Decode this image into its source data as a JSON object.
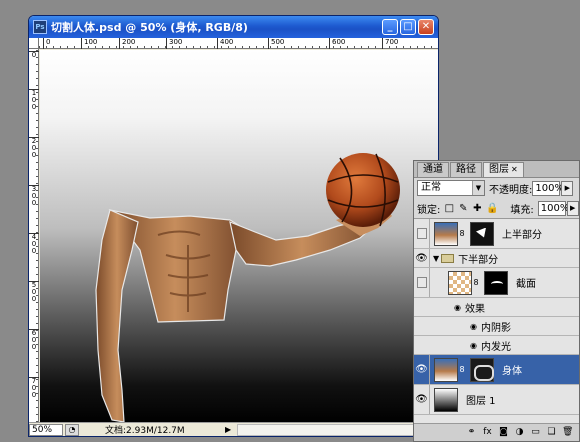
{
  "window": {
    "title": "切割人体.psd @ 50% (身体, RGB/8)",
    "buttons": {
      "minimize": "_",
      "maximize": "□",
      "close": "✕"
    }
  },
  "ruler": {
    "top_ticks": [
      "0",
      "100",
      "200",
      "300",
      "400",
      "500",
      "600",
      "700"
    ],
    "left_ticks": [
      "0",
      "1 0 0",
      "2 0 0",
      "3 0 0",
      "4 0 0",
      "5 0 0",
      "6 0 0",
      "7 0 0"
    ]
  },
  "status": {
    "zoom": "50%",
    "doc_size": "文档:2.93M/12.7M"
  },
  "layers_panel": {
    "tabs": [
      "通道",
      "路径",
      "图层"
    ],
    "active_tab": "图层",
    "blend_mode": "正常",
    "opacity_label": "不透明度:",
    "opacity_value": "100%",
    "lock_label": "锁定:",
    "fill_label": "填充:",
    "fill_value": "100%",
    "layers": [
      {
        "name": "上半部分",
        "visible": false
      },
      {
        "name": "下半部分",
        "group": true,
        "visible": true
      },
      {
        "name": "截面",
        "visible": false
      },
      {
        "name": "效果"
      },
      {
        "name": "内阴影"
      },
      {
        "name": "内发光"
      },
      {
        "name": "身体",
        "visible": true,
        "selected": true
      },
      {
        "name": "图层 1",
        "visible": true
      }
    ],
    "footer_icons": [
      "link-icon",
      "fx-icon",
      "mask-icon",
      "adjustment-icon",
      "folder-icon",
      "new-layer-icon",
      "trash-icon"
    ]
  },
  "colors": {
    "titlebar": "#1e5ad0",
    "selected_layer": "#3762a8",
    "ball": "#b14a1c"
  }
}
